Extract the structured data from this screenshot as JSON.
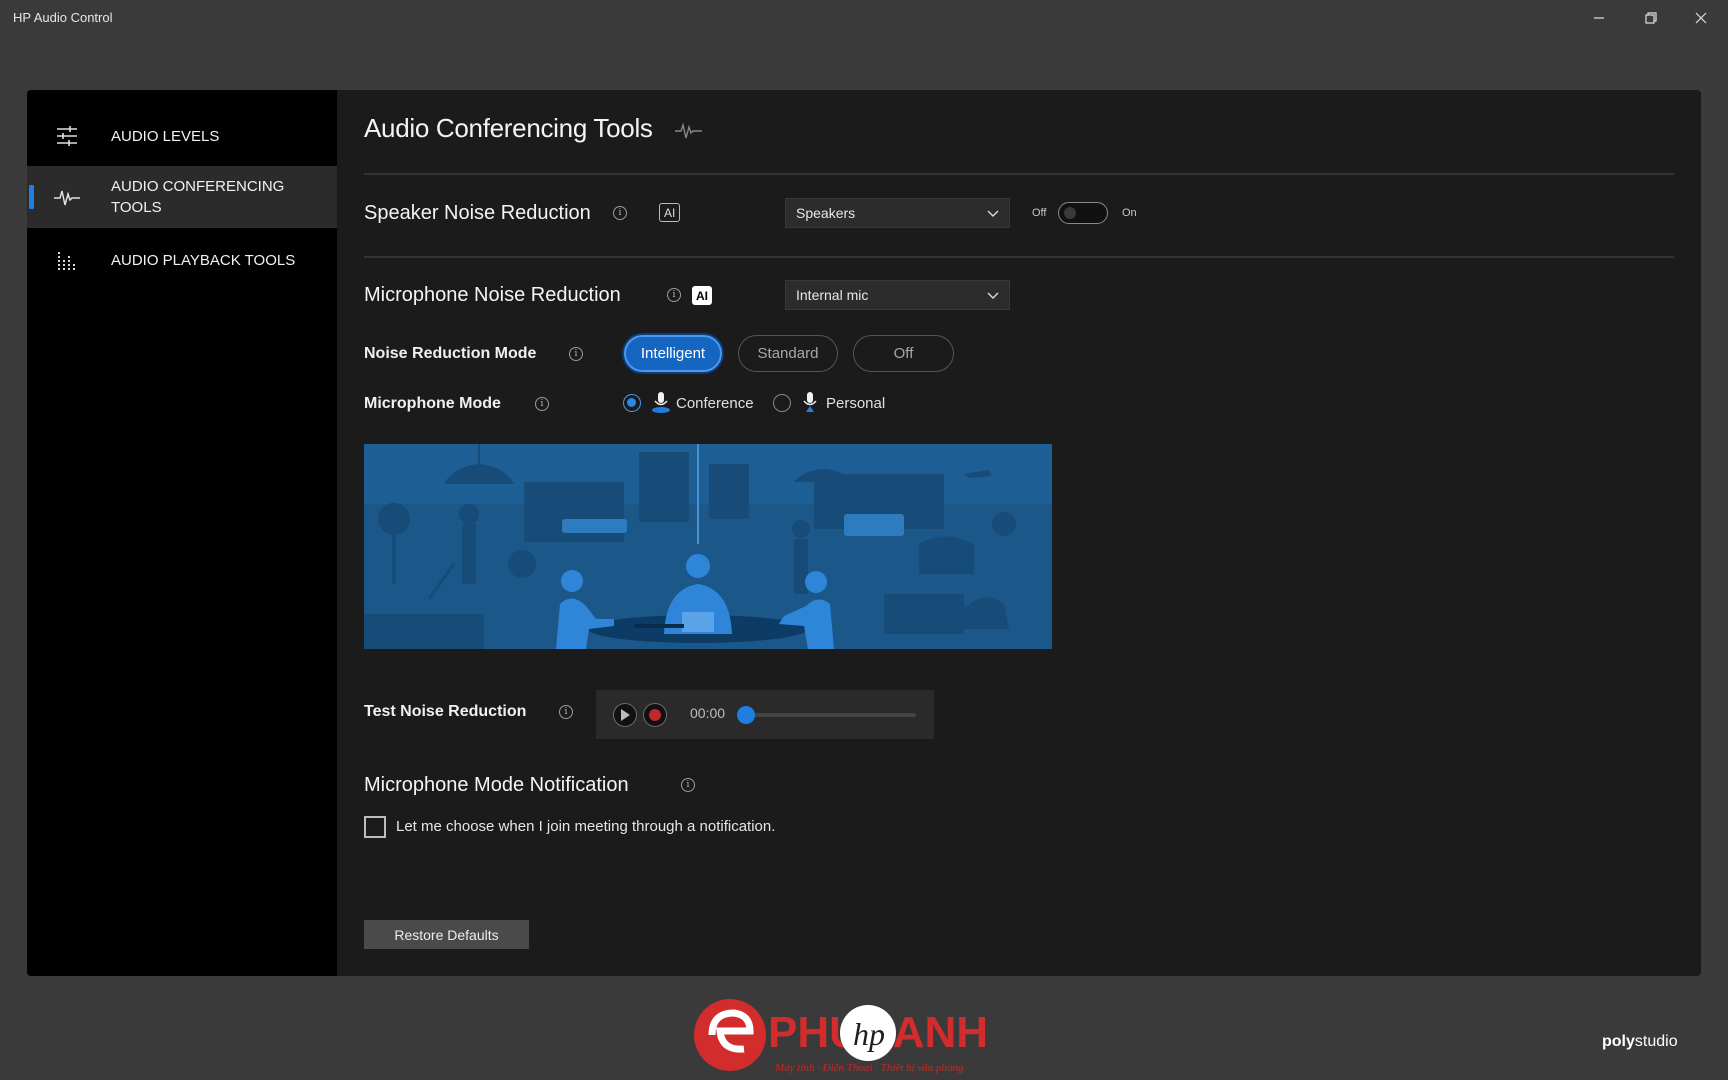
{
  "window": {
    "title": "HP Audio Control"
  },
  "sidebar": {
    "items": [
      {
        "label": "AUDIO LEVELS",
        "icon": "sliders-icon",
        "active": false
      },
      {
        "label": "AUDIO CONFERENCING TOOLS",
        "icon": "waveform-icon",
        "active": true
      },
      {
        "label": "AUDIO PLAYBACK TOOLS",
        "icon": "equalizer-icon",
        "active": false
      }
    ]
  },
  "main": {
    "title": "Audio Conferencing Tools",
    "speaker_nr": {
      "title": "Speaker Noise Reduction",
      "badge": "AI",
      "device": "Speakers",
      "toggle_off_label": "Off",
      "toggle_on_label": "On",
      "enabled": false
    },
    "mic_nr": {
      "title": "Microphone Noise Reduction",
      "badge": "AI",
      "device": "Internal mic"
    },
    "nr_mode": {
      "label": "Noise Reduction Mode",
      "options": [
        "Intelligent",
        "Standard",
        "Off"
      ],
      "selected": "Intelligent"
    },
    "mic_mode": {
      "label": "Microphone Mode",
      "options": [
        "Conference",
        "Personal"
      ],
      "selected": "Conference"
    },
    "test": {
      "label": "Test Noise Reduction",
      "time": "00:00",
      "progress": 0
    },
    "notification": {
      "title": "Microphone Mode Notification",
      "checkbox_label": "Let me choose when I join meeting through a notification.",
      "checked": false
    },
    "restore_label": "Restore Defaults"
  },
  "footer": {
    "watermark_brand": "PHUCANH",
    "watermark_tagline": "Máy tính · Điện Thoại · Thiết bị văn phòng",
    "poly_bold": "poly",
    "poly_rest": "studio"
  },
  "colors": {
    "accent": "#1e7fe0",
    "panel": "#1b1b1b",
    "sidebar": "#000000",
    "illustration": "#1d5e94"
  }
}
